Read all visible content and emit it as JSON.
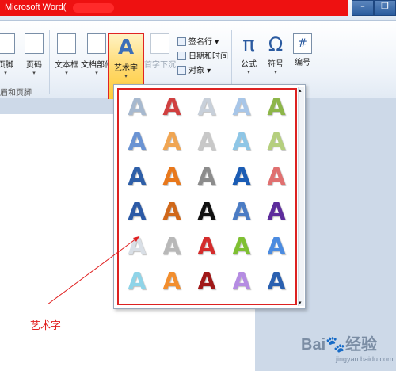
{
  "window": {
    "title": "Microsoft Word(",
    "minimize": "–",
    "maximize": "❐"
  },
  "ribbon": {
    "buttons": [
      {
        "key": "footer",
        "label": "页脚"
      },
      {
        "key": "page_number",
        "label": "页码"
      },
      {
        "key": "textbox",
        "label": "文本框"
      },
      {
        "key": "quick_parts",
        "label": "文档部件"
      },
      {
        "key": "wordart",
        "label": "艺术字"
      },
      {
        "key": "dropcap",
        "label": "首字下沉"
      },
      {
        "key": "equation",
        "label": "公式"
      },
      {
        "key": "symbol",
        "label": "符号"
      },
      {
        "key": "number",
        "label": "编号"
      }
    ],
    "small_items": [
      "签名行 ▾",
      "日期和时间",
      "对象 ▾"
    ],
    "group_label": "眉和页脚",
    "icons": {
      "equation": "π",
      "symbol": "Ω",
      "number": "#"
    }
  },
  "gallery": {
    "glyph": "A",
    "rows": [
      [
        "#a7b9cf",
        "#d04040",
        "#c8d0da",
        "#a8c6e8",
        "#8db649"
      ],
      [
        "#6a93d3",
        "#f0a552",
        "#c8c8c8",
        "#8ec6e6",
        "#b5cf7e"
      ],
      [
        "#2e5fa8",
        "#e8781c",
        "#8c8c8c",
        "#1b5cb4",
        "#e07070"
      ],
      [
        "#2c5aa6",
        "#d0681a",
        "#111111",
        "#4b7cc4",
        "#5d2c9c"
      ],
      [
        "#d9dfe6",
        "#b8b8b8",
        "#d42c2c",
        "#7fc032",
        "#4b8be0"
      ],
      [
        "#8fd4e8",
        "#f28e2e",
        "#a01818",
        "#b58ce2",
        "#2a60b0"
      ]
    ]
  },
  "caption": "艺术字",
  "watermark": {
    "brand": "Bai",
    "paw": "🐾",
    "brand2": "经验",
    "url": "jingyan.baidu.com"
  }
}
